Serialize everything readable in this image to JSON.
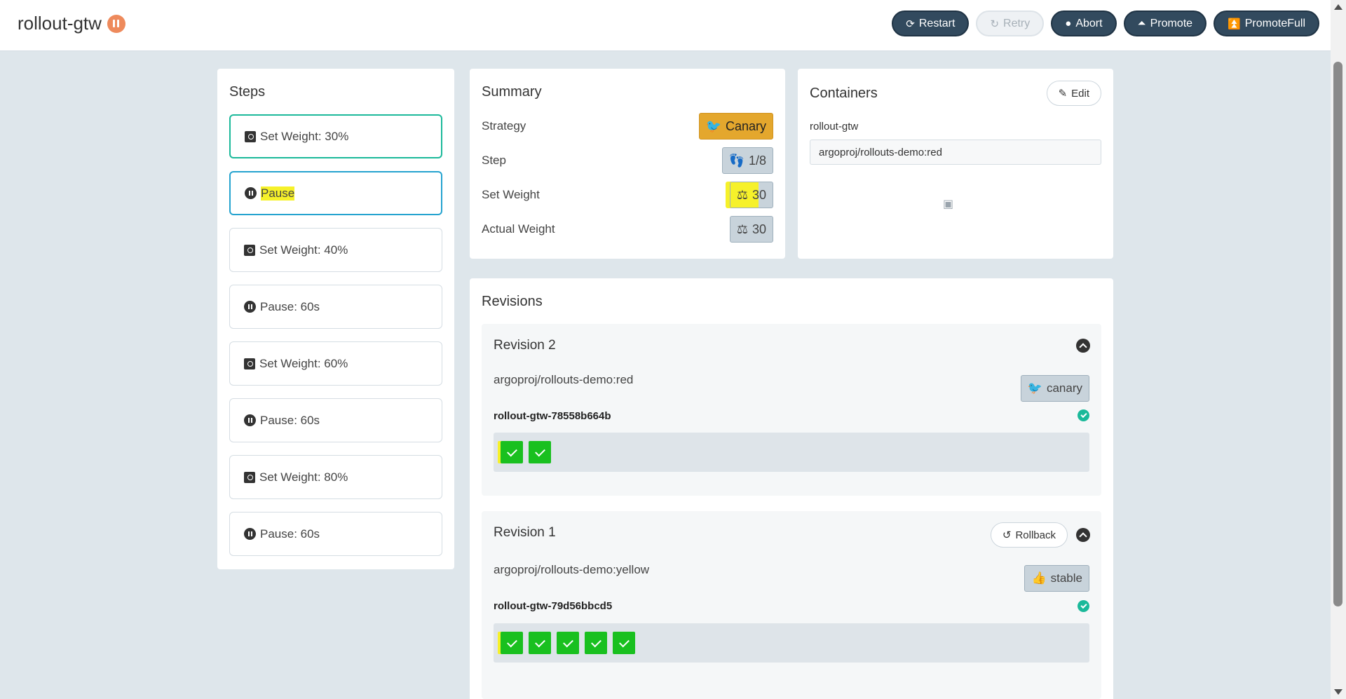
{
  "header": {
    "title": "rollout-gtw",
    "status_icon": "pause-icon",
    "buttons": [
      {
        "label": "Restart",
        "icon": "restart-icon",
        "disabled": false
      },
      {
        "label": "Retry",
        "icon": "retry-icon",
        "disabled": true
      },
      {
        "label": "Abort",
        "icon": "abort-icon",
        "disabled": false
      },
      {
        "label": "Promote",
        "icon": "promote-icon",
        "disabled": false
      },
      {
        "label": "PromoteFull",
        "icon": "promote-full-icon",
        "disabled": false
      }
    ]
  },
  "steps": {
    "title": "Steps",
    "items": [
      {
        "label": "Set Weight: 30%",
        "icon": "weight-icon",
        "state": "done"
      },
      {
        "label": "Pause",
        "icon": "pause-icon",
        "state": "active"
      },
      {
        "label": "Set Weight: 40%",
        "icon": "weight-icon",
        "state": "pending"
      },
      {
        "label": "Pause: 60s",
        "icon": "pause-icon",
        "state": "pending"
      },
      {
        "label": "Set Weight: 60%",
        "icon": "weight-icon",
        "state": "pending"
      },
      {
        "label": "Pause: 60s",
        "icon": "pause-icon",
        "state": "pending"
      },
      {
        "label": "Set Weight: 80%",
        "icon": "weight-icon",
        "state": "pending"
      },
      {
        "label": "Pause: 60s",
        "icon": "pause-icon",
        "state": "pending"
      }
    ]
  },
  "summary": {
    "title": "Summary",
    "rows": [
      {
        "label": "Strategy",
        "value": "Canary",
        "icon": "canary-bird-icon"
      },
      {
        "label": "Step",
        "value": "1/8",
        "icon": "shoe-prints-icon"
      },
      {
        "label": "Set Weight",
        "value": "30",
        "icon": "balance-scale-icon"
      },
      {
        "label": "Actual Weight",
        "value": "30",
        "icon": "balance-scale-icon"
      }
    ]
  },
  "containers": {
    "title": "Containers",
    "edit_label": "Edit",
    "name": "rollout-gtw",
    "image": "argoproj/rollouts-demo:red"
  },
  "revisions": {
    "title": "Revisions",
    "items": [
      {
        "title": "Revision 2",
        "image": "argoproj/rollouts-demo:red",
        "tag": "canary",
        "replicaset": "rollout-gtw-78558b664b",
        "pods": 2
      },
      {
        "title": "Revision 1",
        "rollback_label": "Rollback",
        "image": "argoproj/rollouts-demo:yellow",
        "tag": "stable",
        "replicaset": "rollout-gtw-79d56bbcd5",
        "pods": 5
      }
    ]
  },
  "colors": {
    "accent": "#324a5e",
    "paused": "#ee8a5c",
    "canary": "#e4a72d",
    "healthy": "#19c01f",
    "step_done": "#1bb99a",
    "step_active": "#25a3cf"
  }
}
